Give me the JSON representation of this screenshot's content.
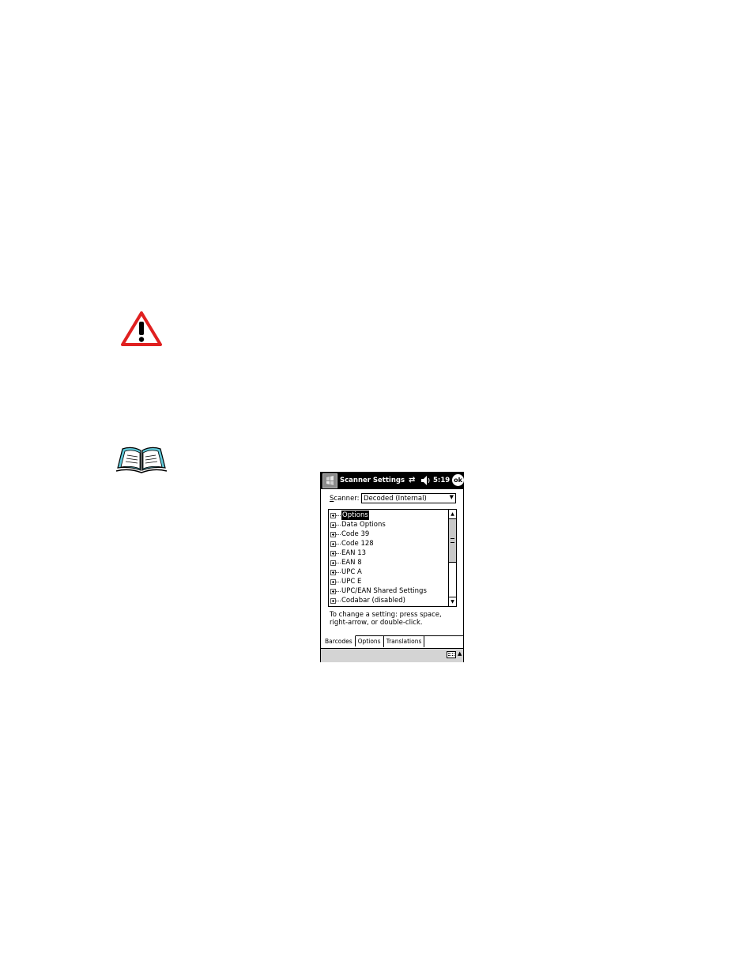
{
  "window": {
    "title": "Scanner Settings",
    "clock": "5:19",
    "ok_label": "ok"
  },
  "scanner": {
    "label": "Scanner:",
    "label_accel": "S",
    "label_rest": "canner:",
    "selected": "Decoded (Internal)"
  },
  "tree": {
    "items": [
      {
        "label": "Options",
        "selected": true
      },
      {
        "label": "Data Options"
      },
      {
        "label": "Code 39"
      },
      {
        "label": "Code 128"
      },
      {
        "label": "EAN 13"
      },
      {
        "label": "EAN 8"
      },
      {
        "label": "UPC A"
      },
      {
        "label": "UPC E"
      },
      {
        "label": "UPC/EAN Shared Settings"
      },
      {
        "label": "Codabar (disabled)"
      }
    ]
  },
  "help": {
    "line1": "To change a setting: press space,",
    "line2": "right-arrow, or double-click."
  },
  "tabs": [
    {
      "label": "Barcodes",
      "active": true
    },
    {
      "label": "Options"
    },
    {
      "label": "Translations"
    }
  ],
  "colors": {
    "warning_red": "#e02020",
    "note_cyan": "#5fc8d8",
    "titlebar": "#000000",
    "menubar": "#d4d4d4"
  }
}
